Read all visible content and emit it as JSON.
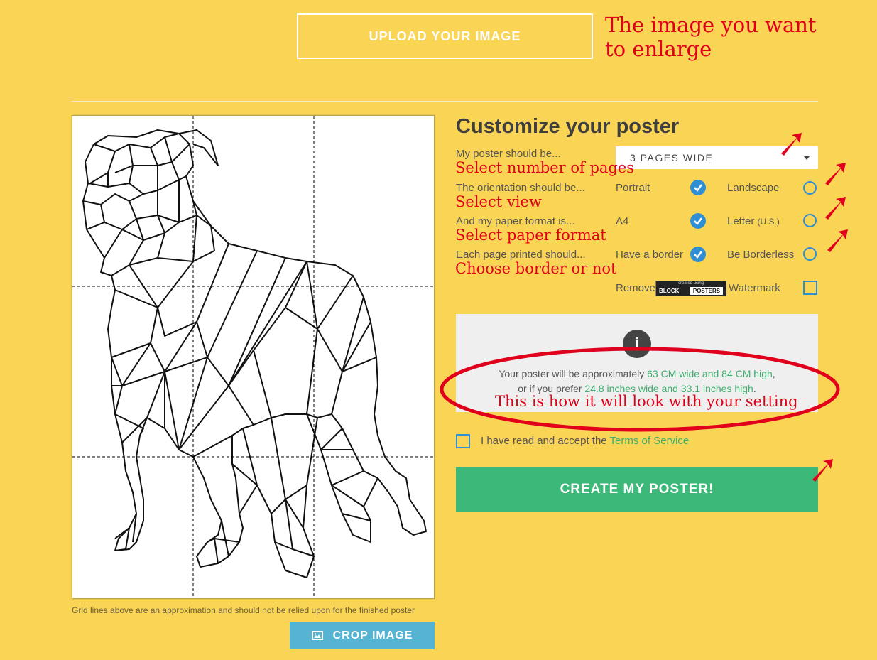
{
  "upload": {
    "label": "UPLOAD YOUR IMAGE"
  },
  "annotations": {
    "upload_note_line1": "The image you want",
    "upload_note_line2": "to enlarge",
    "pages": "Select number of pages",
    "view": "Select view",
    "paper": "Select paper format",
    "border": "Choose border or not",
    "result": "This is how it will look with your setting"
  },
  "preview": {
    "grid_note": "Grid lines above are an approximation and should not be relied upon for the finished poster",
    "crop_label": "CROP IMAGE",
    "image_icon": "image-icon"
  },
  "customize": {
    "title": "Customize your poster",
    "size_label": "My poster should be...",
    "size_value": "3 PAGES WIDE",
    "orientation_label": "The orientation should be...",
    "orientation_opt1": "Portrait",
    "orientation_opt2": "Landscape",
    "paper_label": "And my paper format is...",
    "paper_opt1": "A4",
    "paper_opt2": "Letter",
    "paper_opt2_suffix": "(U.S.)",
    "border_label": "Each page printed should...",
    "border_opt1": "Have a border",
    "border_opt2": "Be Borderless",
    "watermark_prefix": "Remove",
    "watermark_suffix": "Watermark",
    "badge_top": "created using",
    "badge_left": "BLOCK",
    "badge_right": "POSTERS"
  },
  "info": {
    "line1_prefix": "Your poster will be approximately",
    "line1_value": "63 CM wide and 84 CM high",
    "line1_suffix": ",",
    "line2_prefix": "or if you prefer",
    "line2_value": "24.8 inches wide and 33.1 inches high",
    "line2_suffix": "."
  },
  "terms": {
    "prefix": "I have read and accept the",
    "link": "Terms of Service"
  },
  "create": {
    "label": "CREATE MY POSTER!"
  },
  "colors": {
    "background": "#fad555",
    "accent_blue": "#2f8fd2",
    "green": "#3cb878",
    "annotation_red": "#e0001b"
  }
}
